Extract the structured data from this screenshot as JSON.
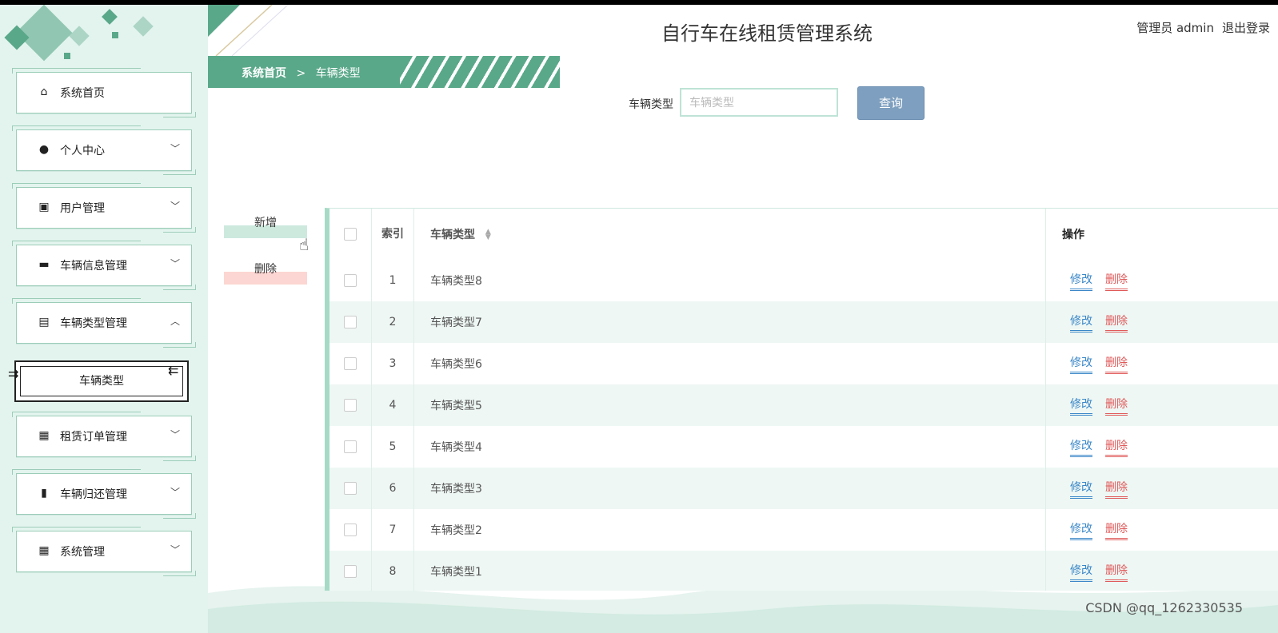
{
  "app": {
    "title": "自行车在线租赁管理系统",
    "user_label": "管理员 admin",
    "logout_label": "退出登录"
  },
  "sidebar": {
    "items": [
      {
        "label": "系统首页",
        "icon": "home-icon",
        "glyph": "⌂"
      },
      {
        "label": "个人中心",
        "icon": "user-icon",
        "glyph": "●"
      },
      {
        "label": "用户管理",
        "icon": "wallet-icon",
        "glyph": "▣"
      },
      {
        "label": "车辆信息管理",
        "icon": "chat-icon",
        "glyph": "▬"
      },
      {
        "label": "车辆类型管理",
        "icon": "briefcase-icon",
        "glyph": "▤"
      },
      {
        "label": "租赁订单管理",
        "icon": "grid-icon",
        "glyph": "▦"
      },
      {
        "label": "车辆归还管理",
        "icon": "clipboard-icon",
        "glyph": "▮"
      },
      {
        "label": "系统管理",
        "icon": "grid-icon",
        "glyph": "▦"
      }
    ],
    "active_sub": "车辆类型"
  },
  "breadcrumb": {
    "home": "系统首页",
    "separator": ">",
    "current": "车辆类型"
  },
  "search": {
    "label": "车辆类型",
    "placeholder": "车辆类型",
    "button": "查询"
  },
  "actions": {
    "add": "新增",
    "delete": "删除"
  },
  "table": {
    "headers": {
      "index": "索引",
      "type": "车辆类型",
      "ops": "操作"
    },
    "rows": [
      {
        "index": "1",
        "type": "车辆类型8"
      },
      {
        "index": "2",
        "type": "车辆类型7"
      },
      {
        "index": "3",
        "type": "车辆类型6"
      },
      {
        "index": "4",
        "type": "车辆类型5"
      },
      {
        "index": "5",
        "type": "车辆类型4"
      },
      {
        "index": "6",
        "type": "车辆类型3"
      },
      {
        "index": "7",
        "type": "车辆类型2"
      },
      {
        "index": "8",
        "type": "车辆类型1"
      }
    ],
    "edit_label": "修改",
    "delete_label": "删除"
  },
  "watermark": "CSDN @qq_1262330535",
  "colors": {
    "primary": "#5aa88a",
    "sidebar_bg": "#e3f4ee",
    "query_button": "#7e9fbf",
    "edit": "#3a87c8",
    "delete": "#e05a5a"
  }
}
